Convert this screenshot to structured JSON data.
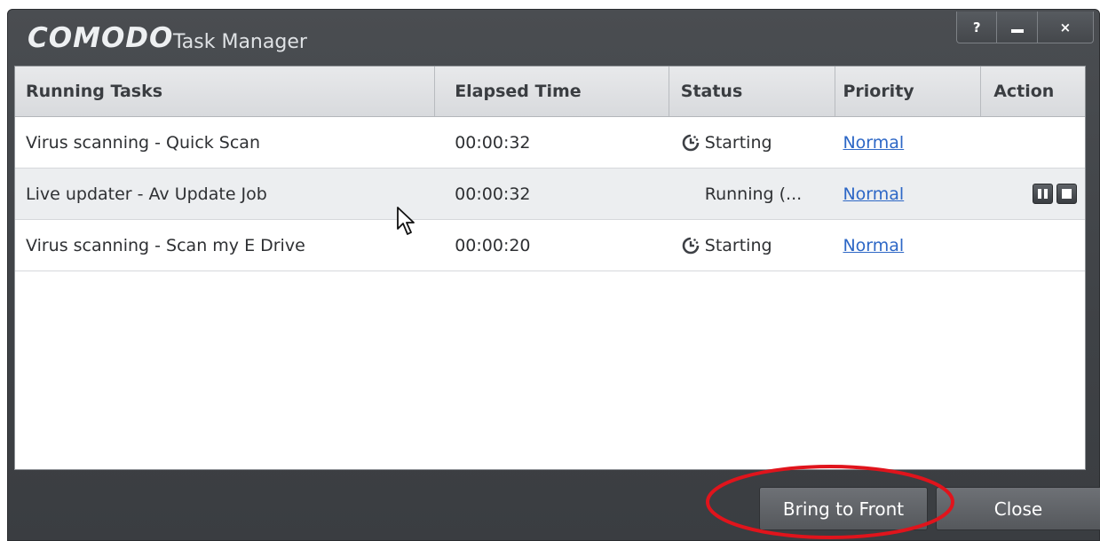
{
  "brand": "COMODO",
  "app_title": "Task Manager",
  "window_controls": {
    "help": "?",
    "close": "×"
  },
  "columns": [
    "Running Tasks",
    "Elapsed Time",
    "Status",
    "Priority",
    "Action"
  ],
  "tasks": [
    {
      "name": "Virus scanning - Quick Scan",
      "elapsed": "00:00:32",
      "status": "Starting",
      "status_icon": "clock-icon",
      "priority": "Normal",
      "actions": []
    },
    {
      "name": "Live updater - Av Update Job",
      "elapsed": "00:00:32",
      "status": "Running (...",
      "status_icon": "",
      "priority": "Normal",
      "actions": [
        "pause-icon",
        "stop-icon"
      ]
    },
    {
      "name": "Virus scanning - Scan my E Drive",
      "elapsed": "00:00:20",
      "status": "Starting",
      "status_icon": "clock-icon",
      "priority": "Normal",
      "actions": []
    }
  ],
  "buttons": {
    "bring_to_front": "Bring to Front",
    "close": "Close"
  },
  "colors": {
    "title_bar": "#3f4246",
    "link": "#2d67c6",
    "highlight_ring": "#e0141c"
  }
}
